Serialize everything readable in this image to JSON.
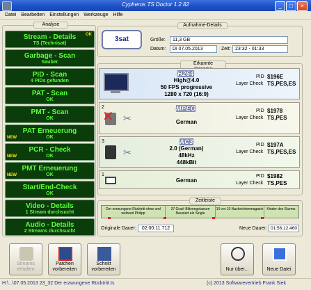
{
  "window": {
    "title": "Cypheros TS Doctor 1.2.82"
  },
  "menu": [
    "Datei",
    "Bearbeiten",
    "Einstellungen",
    "Werkzeuge",
    "Hilfe"
  ],
  "analyse": {
    "title": "Analyse",
    "buttons": [
      {
        "line1": "Stream - Details",
        "line2": "TS (Technisat)",
        "ok": "OK",
        "new": ""
      },
      {
        "line1": "Garbage - Scan",
        "line2": "Sauber",
        "ok": "",
        "new": ""
      },
      {
        "line1": "PID - Scan",
        "line2": "4 PIDs gefunden",
        "ok": "",
        "new": ""
      },
      {
        "line1": "PAT - Scan",
        "line2": "OK",
        "ok": "",
        "new": ""
      },
      {
        "line1": "PMT - Scan",
        "line2": "OK",
        "ok": "",
        "new": ""
      },
      {
        "line1": "PAT Erneuerung",
        "line2": "OK",
        "ok": "",
        "new": "NEW"
      },
      {
        "line1": "PCR - Check",
        "line2": "OK",
        "ok": "",
        "new": "NEW"
      },
      {
        "line1": "PMT Erneuerung",
        "line2": "OK",
        "ok": "",
        "new": "NEW"
      },
      {
        "line1": "Start/End-Check",
        "line2": "OK",
        "ok": "",
        "new": ""
      },
      {
        "line1": "Video - Details",
        "line2": "1 Stream durchsucht",
        "ok": "",
        "new": ""
      },
      {
        "line1": "Audio - Details",
        "line2": "2 Streams durchsucht",
        "ok": "",
        "new": ""
      }
    ]
  },
  "aufnahme": {
    "title": "Aufnahme-Details",
    "channel": "3sat",
    "size_label": "Größe:",
    "size": "11,3 GB",
    "date_label": "Datum:",
    "date": "Di 07.05.2013",
    "time_label": "Zeit:",
    "time": "23:32 - 01:33"
  },
  "streams": {
    "title": "Erkannte Streams",
    "items": [
      {
        "index": "",
        "codec": "H264",
        "lines": [
          "High@4.0",
          "50 FPS progressive",
          "1280 x 720 (16:9)"
        ],
        "pid_label": "PID",
        "pid": "$196E",
        "lc_label": "Layer Check",
        "lc": "TS,PES,ES"
      },
      {
        "index": "2",
        "codec": "MPEG",
        "lines": [
          "German"
        ],
        "pid_label": "PID",
        "pid": "$1978",
        "lc_label": "Layer Check",
        "lc": "TS,PES"
      },
      {
        "index": "3",
        "codec": "AC3",
        "lines": [
          "2.0 (German)",
          "48kHz",
          "448kBit"
        ],
        "pid_label": "PID",
        "pid": "$197A",
        "lc_label": "Layer Check",
        "lc": "TS,PES,ES"
      },
      {
        "index": "1",
        "codec": "",
        "lines": [
          "German"
        ],
        "pid_label": "PID",
        "pid": "$1982",
        "lc_label": "Layer Check",
        "lc": "TS,PES"
      }
    ]
  },
  "zeitleiste": {
    "title": "Zeitleiste",
    "segments": [
      "Der erzwungene Rücktritt ohne und weltweit Philipp",
      "37 Grad: Blitzengelassen Neustart als Single",
      "10 vor 10 Nachrichtenmagazin",
      "Kinder des Sturms"
    ],
    "orig_label": "Originale Dauer:",
    "orig": "02:00:11.712",
    "new_label": "Neue Dauer:",
    "new": "01:56:12.460"
  },
  "bottom_buttons": {
    "streams": "Streams erhalten",
    "patch": "Patchen vorbereiten",
    "cut": "Schnitt vorbereiten",
    "nur": "Nur über...",
    "neue": "Neue Datei"
  },
  "status": {
    "path": "H:\\...\\07.05.2013 23_32 Der erzwungene Rücktritt.ts",
    "copyright": "(c) 2013 Softwarevertrieb Frank Siek"
  },
  "colors": {
    "green_text": "#5cff3c",
    "new_text": "#ffe21a",
    "button_bg": "#0a3d0a"
  }
}
